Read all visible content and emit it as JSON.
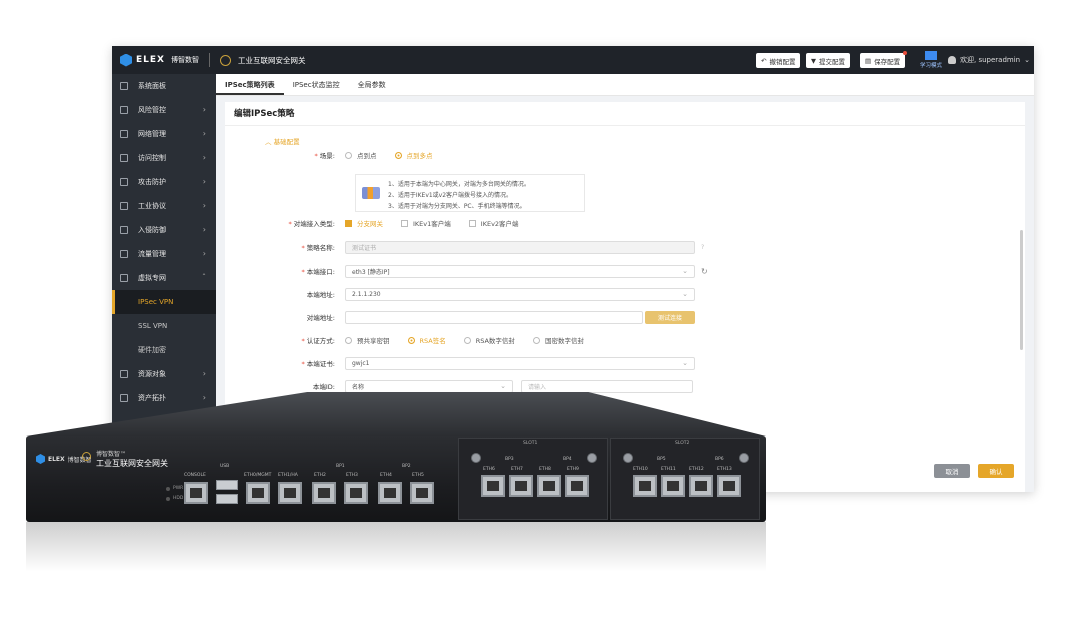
{
  "app": {
    "logo_text": "ELEX",
    "logo_cn": "博智数智",
    "product": "工业互联网安全网关"
  },
  "toolbar": {
    "revert": "撤销配置",
    "submit": "提交配置",
    "save": "保存配置",
    "learn": "学习模式",
    "user": "欢迎, superadmin"
  },
  "sidebar": {
    "items": [
      {
        "label": "系统面板"
      },
      {
        "label": "风险管控"
      },
      {
        "label": "网络管理"
      },
      {
        "label": "访问控制"
      },
      {
        "label": "攻击防护"
      },
      {
        "label": "工业协议"
      },
      {
        "label": "入侵防御"
      },
      {
        "label": "流量管理"
      },
      {
        "label": "虚拟专网"
      },
      {
        "label": "IPSec VPN"
      },
      {
        "label": "SSL VPN"
      },
      {
        "label": "硬件加密"
      },
      {
        "label": "资源对象"
      },
      {
        "label": "资产拓扑"
      }
    ]
  },
  "tabs": [
    "IPSec策略列表",
    "IPSec状态监控",
    "全局参数"
  ],
  "form": {
    "title": "编辑IPSec策略",
    "section": "基础配置",
    "scene_label": "场景:",
    "scene_options": [
      "点到点",
      "点到多点"
    ],
    "hints": [
      "1、适用于本端为中心网关，对端为多台网关的情况。",
      "2、适用于IKEv1或v2客户端拨号接入的情况。",
      "3、适用于对端为分支网关、PC、手机终端等情况。"
    ],
    "peer_type_label": "对端接入类型:",
    "peer_type_options": [
      "分支网关",
      "IKEv1客户端",
      "IKEv2客户端"
    ],
    "name_label": "策略名称:",
    "name_placeholder": "测试证书",
    "local_iface_label": "本端接口:",
    "local_iface_value": "eth3 [静态IP]",
    "local_addr_label": "本端地址:",
    "local_addr_value": "2.1.1.230",
    "peer_addr_label": "对端地址:",
    "peer_addr_button": "测试连接",
    "auth_label": "认证方式:",
    "auth_options": [
      "预共享密钥",
      "RSA签名",
      "RSA数字信封",
      "国密数字信封"
    ],
    "cert_label": "本端证书:",
    "cert_value": "gwjc1",
    "local_id_label": "本端ID:",
    "local_id_value": "名称",
    "local_id_placeholder": "请输入",
    "cancel": "取消",
    "confirm": "确认"
  },
  "device": {
    "brand": "ELEX",
    "brand_cn": "博智数智",
    "name_small": "博智数智™",
    "name": "工业互联网安全网关",
    "ports": [
      "CONSOLE",
      "USB",
      "ETH0/MGMT",
      "ETH1/HA",
      "ETH2",
      "ETH3",
      "ETH4",
      "ETH5"
    ],
    "bp_labels": [
      "BP1",
      "BP2"
    ],
    "leds": [
      "PWR",
      "HDD"
    ],
    "slot1": {
      "label": "SLOT1",
      "ports": [
        "ETH6",
        "ETH7",
        "ETH8",
        "ETH9"
      ],
      "bp": [
        "BP3",
        "BP4"
      ]
    },
    "slot2": {
      "label": "SLOT2",
      "ports": [
        "ETH10",
        "ETH11",
        "ETH12",
        "ETH13"
      ],
      "bp": [
        "BP5",
        "BP6"
      ]
    }
  },
  "colors": {
    "accent": "#e5a629",
    "sidebar": "#2a2f36",
    "topbar": "#1f2329"
  }
}
